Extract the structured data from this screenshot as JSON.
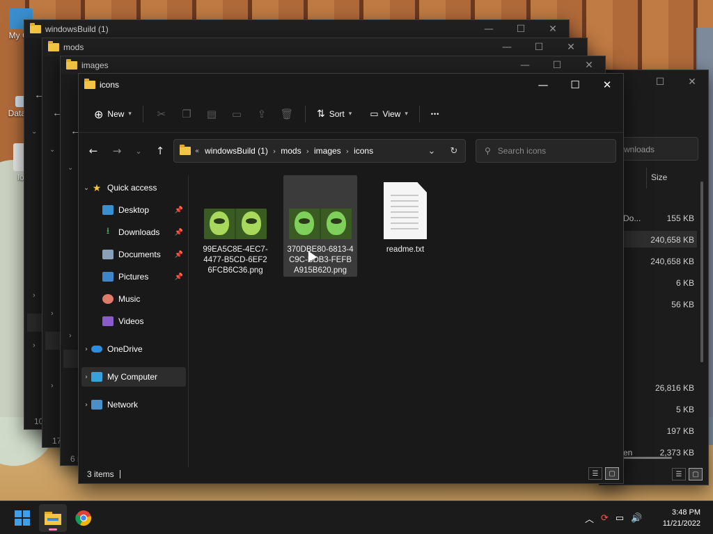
{
  "desktop": {
    "icons": [
      {
        "label": "My Co"
      },
      {
        "label": "DataW"
      },
      {
        "label": "lo"
      }
    ]
  },
  "background_windows": [
    {
      "title": "windowsBuild (1)",
      "status_fragment": "10"
    },
    {
      "title": "mods",
      "status_fragment": "17"
    },
    {
      "title": "images",
      "status_fragment": "6 i"
    }
  ],
  "right_window": {
    "search_fragment": "wnloads",
    "size_header": "Size",
    "name_fragment": "Do...",
    "sizes": [
      "155 KB",
      "240,658 KB",
      "240,658 KB",
      "6 KB",
      "56 KB",
      "26,816 KB",
      "5 KB",
      "197 KB",
      "2,373 KB"
    ],
    "name_tail": "en"
  },
  "main_window": {
    "title": "icons",
    "toolbar": {
      "new_label": "New",
      "sort_label": "Sort",
      "view_label": "View",
      "more_label": "•••"
    },
    "address": {
      "overflow": "«",
      "crumbs": [
        "windowsBuild (1)",
        "mods",
        "images",
        "icons"
      ]
    },
    "search": {
      "placeholder": "Search icons"
    },
    "sidebar": {
      "quick_access": "Quick access",
      "items": [
        {
          "label": "Desktop",
          "pinned": true
        },
        {
          "label": "Downloads",
          "pinned": true
        },
        {
          "label": "Documents",
          "pinned": true
        },
        {
          "label": "Pictures",
          "pinned": true
        },
        {
          "label": "Music",
          "pinned": false
        },
        {
          "label": "Videos",
          "pinned": false
        }
      ],
      "onedrive": "OneDrive",
      "my_computer": "My Computer",
      "network": "Network"
    },
    "files": [
      {
        "name": "99EA5C8E-4EC7-4477-B5CD-6EF26FCB6C36.png",
        "line1": "99EA5C8E-4EC7-",
        "line2": "4477-B5CD-6EF2",
        "line3": "6FCB6C36.png",
        "selected": false
      },
      {
        "name": "370DBE80-6813-4C9C-BDB3-FEFBA915B620.png",
        "line1": "370DBE80-6813-4",
        "line2": "C9C-BDB3-FEFB",
        "line3": "A915B620.png",
        "selected": true
      },
      {
        "name": "readme.txt",
        "line1": "readme.txt",
        "selected": false
      }
    ],
    "status": "3 items"
  },
  "taskbar": {
    "time": "3:48 PM",
    "date": "11/21/2022"
  },
  "colors": {
    "window_bg": "#191919",
    "accent_folder": "#f4c542",
    "selection": "#3b3b3b"
  }
}
